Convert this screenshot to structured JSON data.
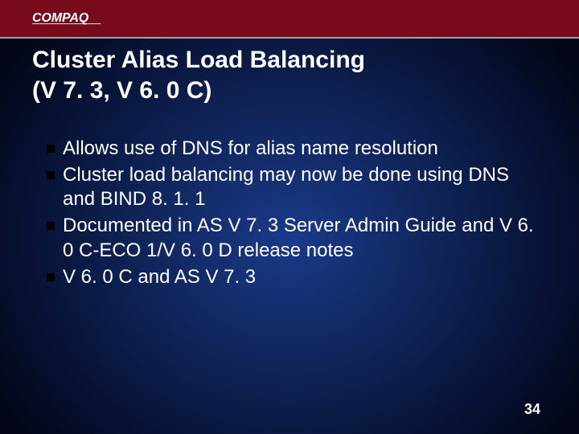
{
  "brand": "COMPAQ",
  "title": {
    "line1": "Cluster Alias Load Balancing",
    "line2": "(V 7. 3, V 6. 0 C)"
  },
  "bullets": [
    "Allows use of DNS for alias name resolution",
    "Cluster load balancing may now be done using DNS and BIND 8. 1. 1",
    "Documented in AS V 7. 3 Server Admin Guide and V 6. 0 C-ECO 1/V 6. 0 D release notes",
    "V 6. 0 C and AS V 7. 3"
  ],
  "page_number": "34"
}
